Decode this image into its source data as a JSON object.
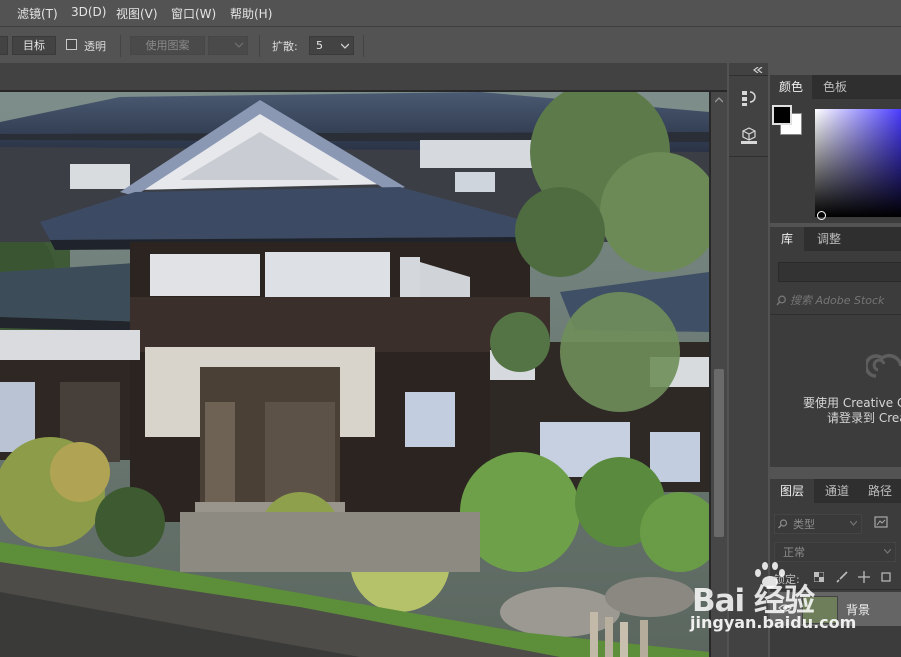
{
  "menubar": {
    "items": [
      {
        "label": "滤镜(T)"
      },
      {
        "label": "3D(D)"
      },
      {
        "label": "视图(V)"
      },
      {
        "label": "窗口(W)"
      },
      {
        "label": "帮助(H)"
      }
    ]
  },
  "options": {
    "target_label": "目标",
    "transparent_label": "透明",
    "use_pattern_label": "使用图案",
    "diffuse_label": "扩散:",
    "diffuse_value": "5"
  },
  "color_panel": {
    "tab_color": "颜色",
    "tab_swatches": "色板",
    "foreground": "#000000",
    "background": "#ffffff"
  },
  "library_panel": {
    "tab_library": "库",
    "tab_adjust": "调整",
    "search_placeholder": "搜索 Adobe Stock",
    "message_line1": "要使用 Creative Cl",
    "message_line2": "请登录到 Crea"
  },
  "layers_panel": {
    "tab_layers": "图层",
    "tab_channels": "通道",
    "tab_paths": "路径",
    "filter_kind": "类型",
    "blend_mode": "正常",
    "lock_label": "锁定:",
    "layer_name": "背景"
  },
  "watermark": {
    "brand": "Bai 经验",
    "url": "jingyan.baidu.com"
  }
}
